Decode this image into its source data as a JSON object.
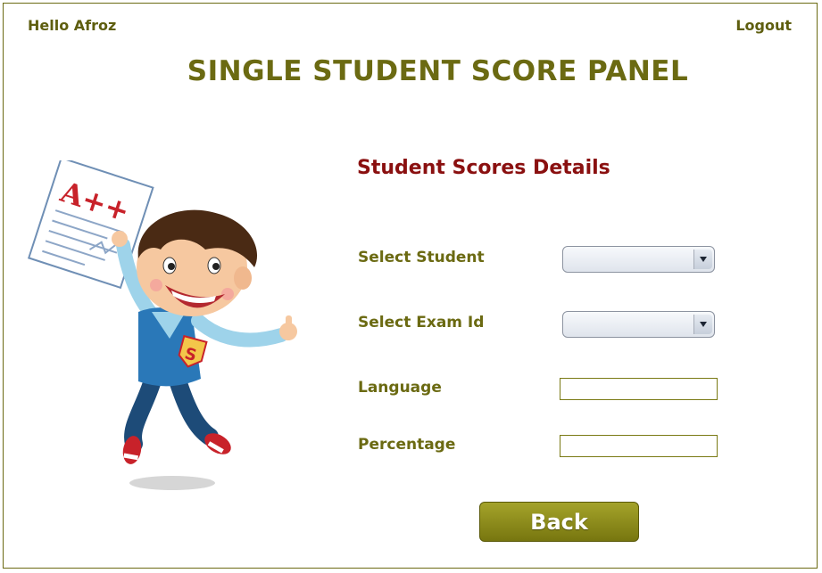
{
  "header": {
    "greeting": "Hello Afroz",
    "logout_label": "Logout"
  },
  "page_title": "SINGLE STUDENT SCORE PANEL",
  "section_title": "Student Scores Details",
  "form": {
    "select_student_label": "Select Student",
    "select_student_value": "",
    "select_exam_label": "Select Exam Id",
    "select_exam_value": "",
    "language_label": "Language",
    "language_value": "",
    "percentage_label": "Percentage",
    "percentage_value": ""
  },
  "illustration": {
    "paper_text": "A++",
    "shirt_badge": "S"
  },
  "actions": {
    "back_label": "Back"
  },
  "colors": {
    "olive": "#6b6a12",
    "title_red": "#8a1010",
    "button": "#8f8e1e"
  }
}
